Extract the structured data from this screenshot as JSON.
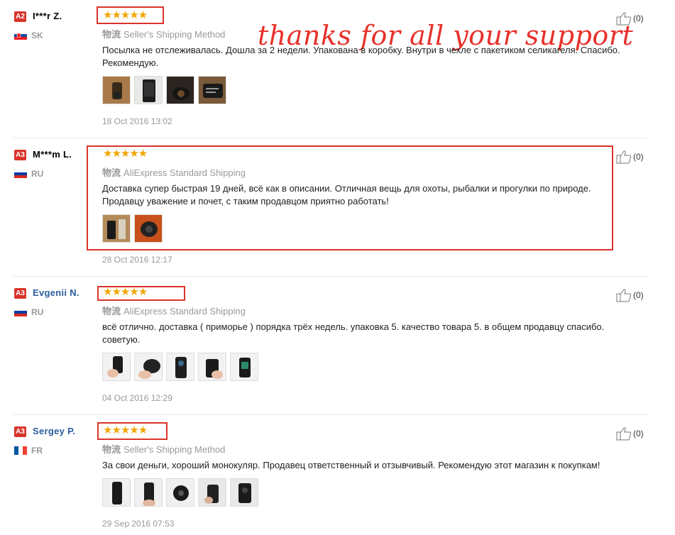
{
  "overlay": {
    "text": "thanks for all your support"
  },
  "reviews": [
    {
      "badge": "A2",
      "user": "I***r Z.",
      "country": "SK",
      "stars": "★★★★★",
      "shipping_label": "物流",
      "shipping": "Seller's Shipping Method",
      "text": "Посылка не отслеживалась. Дошла за 2 недели. Упакована в коробку. Внутри в чехле с пакетиком селикагеля. Спасибо. Рекомендую.",
      "date": "18 Oct 2016 13:02",
      "likes": "(0)"
    },
    {
      "badge": "A3",
      "user": "M***m L.",
      "country": "RU",
      "stars": "★★★★★",
      "shipping_label": "物流",
      "shipping": "AliExpress Standard Shipping",
      "text": "Доставка супер быстрая 19 дней, всё как в описании. Отличная вещь для охоты, рыбалки и прогулки по природе. Продавцу уважение и почет, с таким продавцом приятно работать!",
      "date": "28 Oct 2016 12:17",
      "likes": "(0)"
    },
    {
      "badge": "A3",
      "user": "Evgenii N.",
      "country": "RU",
      "stars": "★★★★★",
      "shipping_label": "物流",
      "shipping": "AliExpress Standard Shipping",
      "text": "всё отлично. доставка ( приморье ) порядка трёх недель. упаковка 5. качество товара 5. в общем продавцу спасибо. советую.",
      "date": "04 Oct 2016 12:29",
      "likes": "(0)"
    },
    {
      "badge": "A3",
      "user": "Sergey P.",
      "country": "FR",
      "stars": "★★★★★",
      "shipping_label": "物流",
      "shipping": "Seller's Shipping Method",
      "text": "За свои деньги, хороший монокуляр. Продавец ответственный и отзывчивый. Рекомендую этот магазин к покупкам!",
      "date": "29 Sep 2016 07:53",
      "likes": "(0)"
    }
  ]
}
